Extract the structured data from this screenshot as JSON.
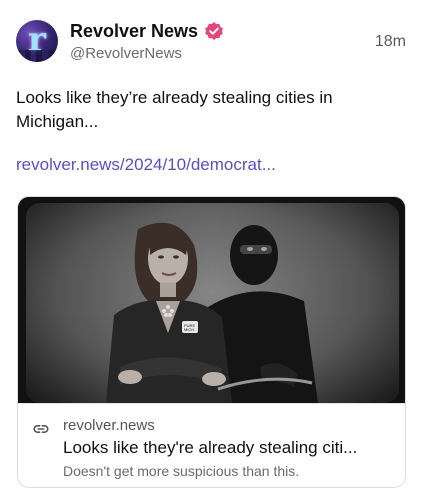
{
  "author": {
    "display_name": "Revolver News",
    "handle": "@RevolverNews",
    "avatar_letter": "r",
    "verified_color": "#e8437a"
  },
  "timestamp": "18m",
  "post": {
    "text": "Looks like they’re already stealing cities in Michigan...",
    "link_text": "revolver.news/2024/10/democrat..."
  },
  "link_card": {
    "domain": "revolver.news",
    "title": "Looks like they're already stealing citi...",
    "description": "Doesn't get more suspicious than this.",
    "image_badge_text": "Pure Michigan",
    "image_description_icon": "link-icon"
  },
  "colors": {
    "link": "#5f4bd0",
    "secondary_text": "#6b6b6b"
  }
}
